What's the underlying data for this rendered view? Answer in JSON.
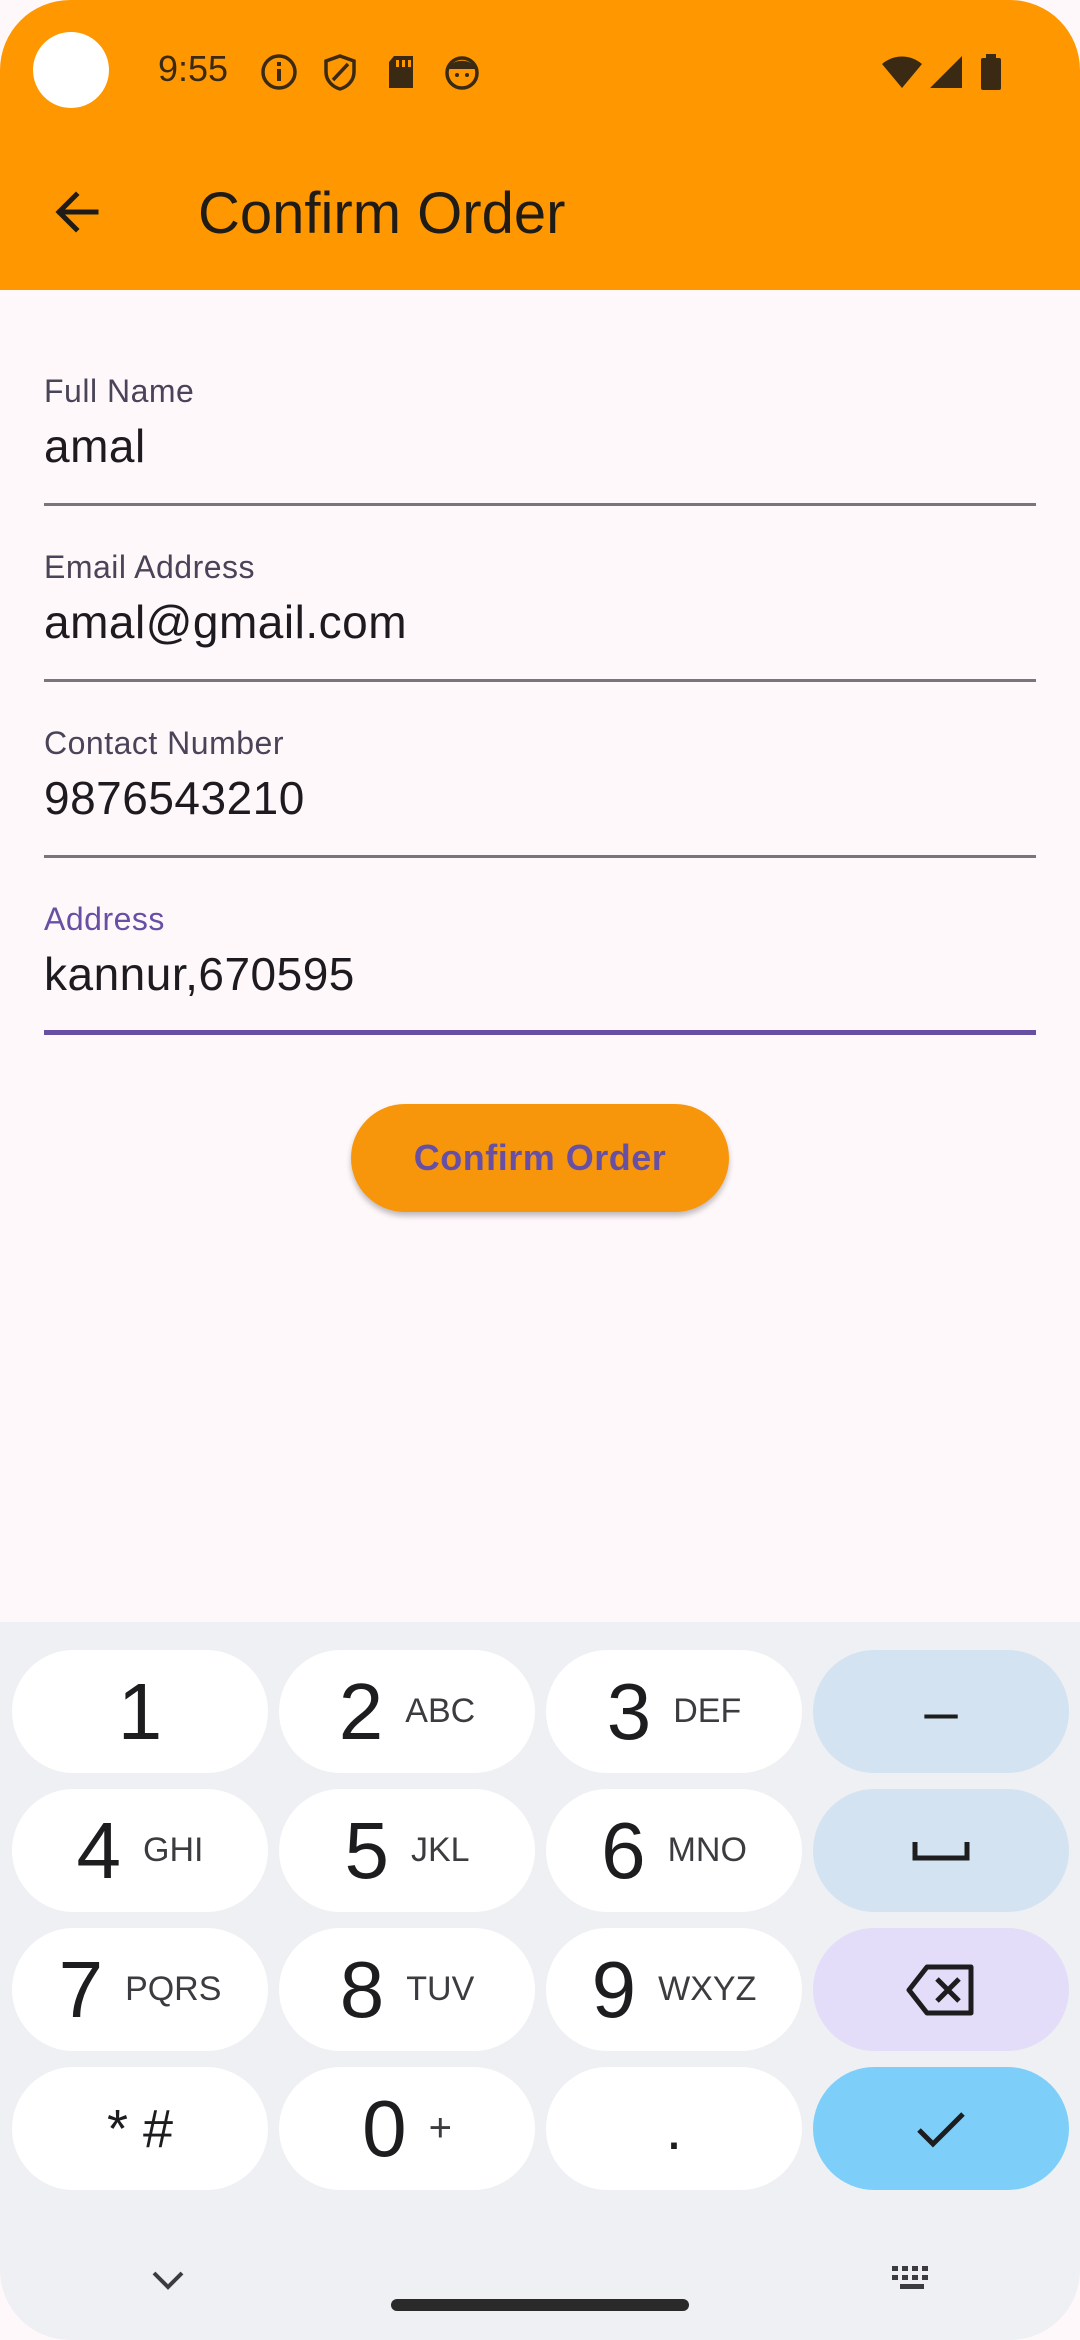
{
  "status_bar": {
    "time": "9:55",
    "left_icons": [
      "info-icon",
      "shield-icon",
      "sd-card-icon",
      "face-icon"
    ],
    "right_icons": [
      "wifi-icon",
      "signal-icon",
      "battery-icon"
    ]
  },
  "app_bar": {
    "title": "Confirm Order",
    "back_icon": "arrow-back-icon",
    "color": "#ff9800"
  },
  "form": {
    "fields": [
      {
        "label": "Full Name",
        "value": "amal"
      },
      {
        "label": "Email Address",
        "value": "amal@gmail.com"
      },
      {
        "label": "Contact Number",
        "value": "9876543210"
      },
      {
        "label": "Address",
        "value": "kannur,670595",
        "focused": true
      }
    ],
    "submit_label": "Confirm Order",
    "accent": "#6750a4"
  },
  "keyboard": {
    "rows": [
      [
        {
          "main": "1",
          "sub": ""
        },
        {
          "main": "2",
          "sub": "ABC"
        },
        {
          "main": "3",
          "sub": "DEF"
        },
        {
          "main": "–",
          "sub": ""
        }
      ],
      [
        {
          "main": "4",
          "sub": "GHI"
        },
        {
          "main": "5",
          "sub": "JKL"
        },
        {
          "main": "6",
          "sub": "MNO"
        },
        {
          "main": "space-icon",
          "sub": ""
        }
      ],
      [
        {
          "main": "7",
          "sub": "PQRS"
        },
        {
          "main": "8",
          "sub": "TUV"
        },
        {
          "main": "9",
          "sub": "WXYZ"
        },
        {
          "main": "backspace-icon",
          "sub": ""
        }
      ],
      [
        {
          "main": "* #",
          "sub": ""
        },
        {
          "main": "0",
          "sub": "+"
        },
        {
          "main": ".",
          "sub": ""
        },
        {
          "main": "check-icon",
          "sub": ""
        }
      ]
    ],
    "bottom_icons": [
      "chevron-down-icon",
      "keyboard-icon"
    ]
  }
}
